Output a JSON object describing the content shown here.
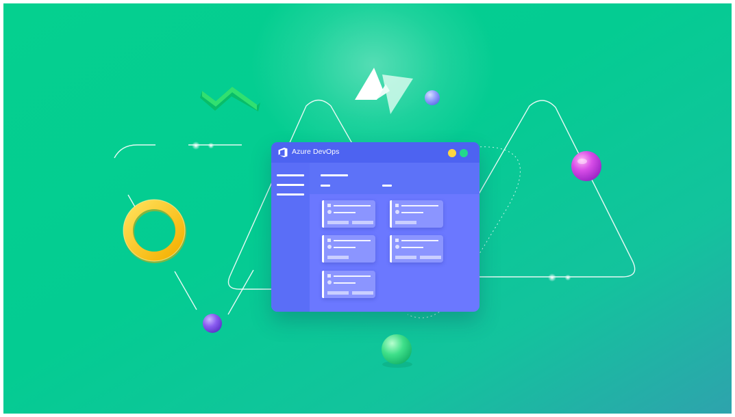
{
  "window": {
    "title": "Azure DevOps",
    "logo_icon": "azure-devops-icon"
  },
  "colors": {
    "background_start": "#05d08f",
    "background_end": "#2ea3ad",
    "window_body": "#6b78ff",
    "window_titlebar": "#4d63f1",
    "dot_yellow": "#ffd640",
    "dot_green": "#22d88c",
    "ring": "#ffc21a"
  },
  "decorations": [
    "triangle-outline-icon",
    "zigzag-icon",
    "torus-ring-icon",
    "sphere-icon",
    "nuxt-logo-icon"
  ]
}
